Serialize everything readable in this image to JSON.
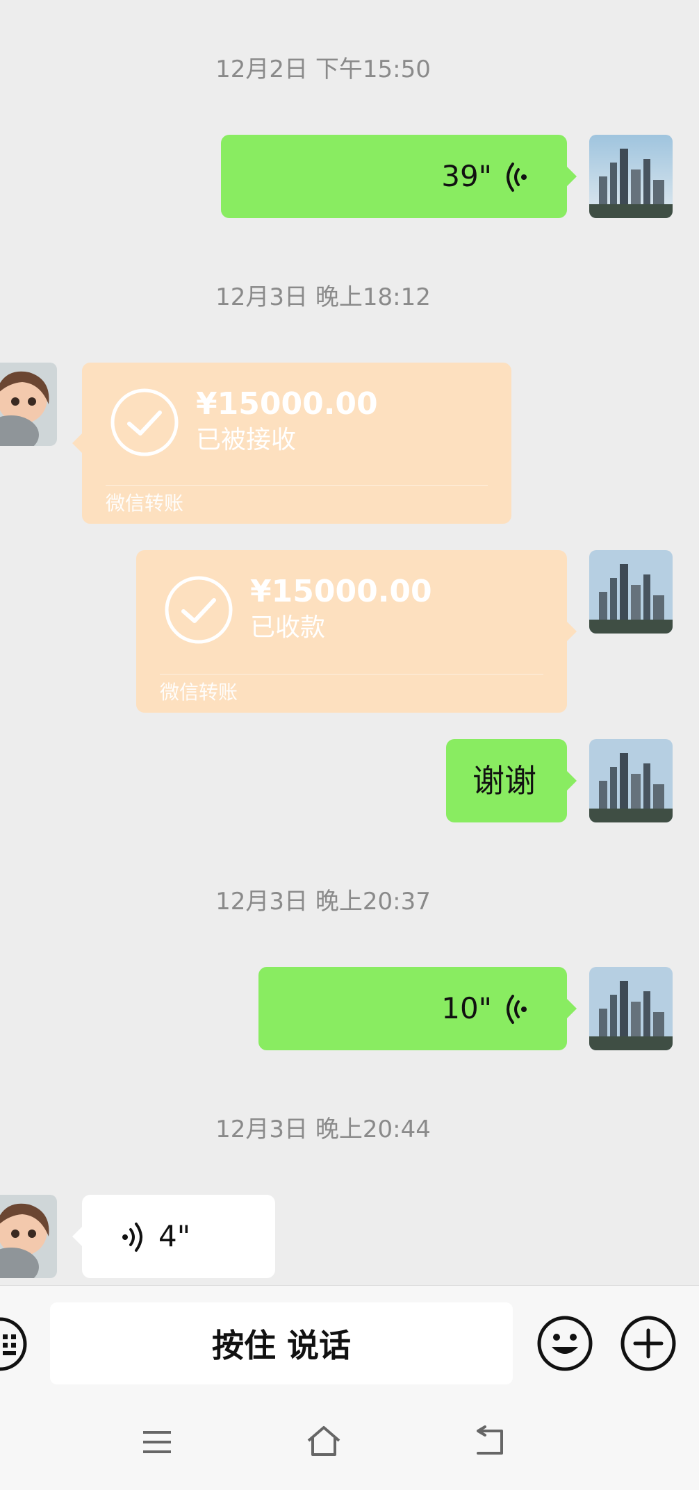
{
  "messages": {
    "t1": "12月2日 下午15:50",
    "voice1_duration": "39\"",
    "t2": "12月3日 晚上18:12",
    "transfer_in": {
      "amount": "¥15000.00",
      "status": "已被接收",
      "label": "微信转账"
    },
    "transfer_out": {
      "amount": "¥15000.00",
      "status": "已收款",
      "label": "微信转账"
    },
    "thanks_text": "谢谢",
    "t3": "12月3日 晚上20:37",
    "voice2_duration": "10\"",
    "t4": "12月3日 晚上20:44",
    "voice3_duration": "4\""
  },
  "input_bar": {
    "hold_to_talk": "按住 说话",
    "icons": [
      "keyboard-icon",
      "emoji-icon",
      "plus-icon"
    ]
  },
  "nav": {
    "icons": [
      "menu-icon",
      "home-icon",
      "back-icon"
    ]
  },
  "colors": {
    "background": "#ededed",
    "bubble_green": "#89ec61",
    "transfer_orange": "#fde0bf",
    "timestamp_gray": "#8a8a8a"
  }
}
